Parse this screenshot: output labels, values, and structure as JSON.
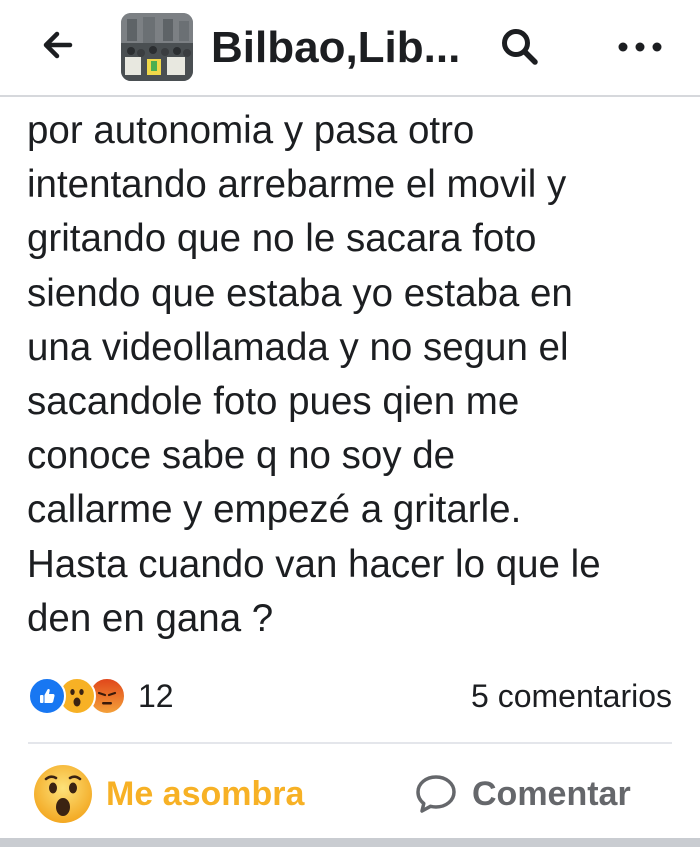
{
  "header": {
    "title": "Bilbao,Lib...",
    "back_icon": "arrow-left-icon",
    "search_icon": "search-icon",
    "more_icon": "more-horizontal-icon"
  },
  "post": {
    "lines": [
      "por autonomia y pasa otro",
      "intentando arrebarme el movil y",
      "gritando que no le sacara foto",
      "siendo que estaba yo estaba en",
      "una videollamada y no segun el",
      "sacandole foto pues qien me",
      "conoce sabe q no soy de",
      "callarme y empezé a gritarle.",
      "Hasta cuando van hacer lo que le",
      "den en gana ?"
    ]
  },
  "reactions": {
    "types": [
      "like",
      "wow",
      "angry"
    ],
    "count": "12"
  },
  "comments": {
    "count_label": "5 comentarios"
  },
  "actions": {
    "react_label": "Me asombra",
    "comment_label": "Comentar"
  },
  "colors": {
    "like_blue": "#1877f2",
    "wow_yellow": "#f7b125",
    "angry_orange": "#e9710f",
    "secondary_text": "#65676b"
  }
}
